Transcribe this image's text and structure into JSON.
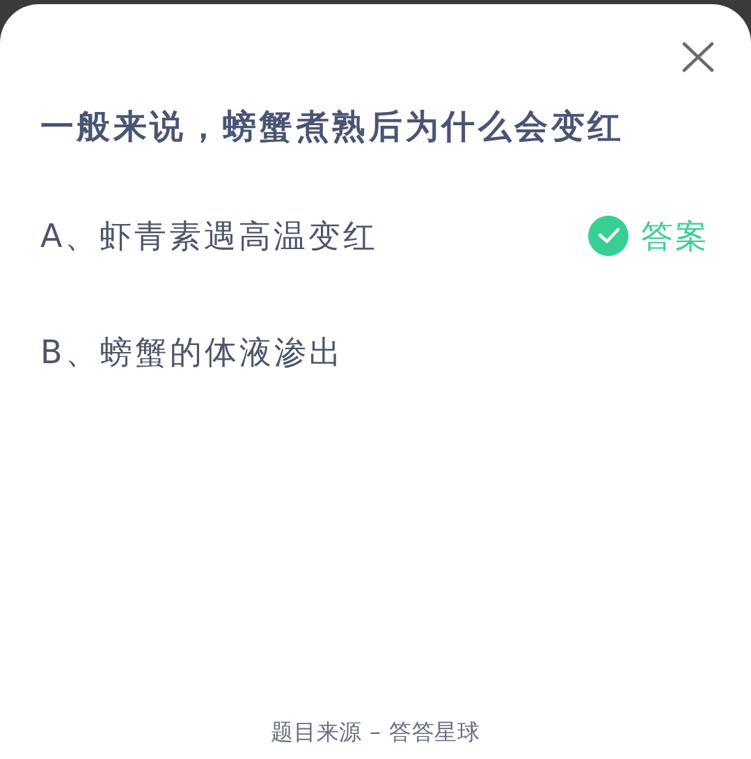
{
  "sheet": {
    "question": "一般来说，螃蟹煮熟后为什么会变红",
    "options": [
      {
        "label": "A、虾青素遇高温变红",
        "correct": true,
        "answer_tag": "答案"
      },
      {
        "label": "B、螃蟹的体液渗出",
        "correct": false
      }
    ],
    "source": "题目来源 – 答答星球"
  }
}
